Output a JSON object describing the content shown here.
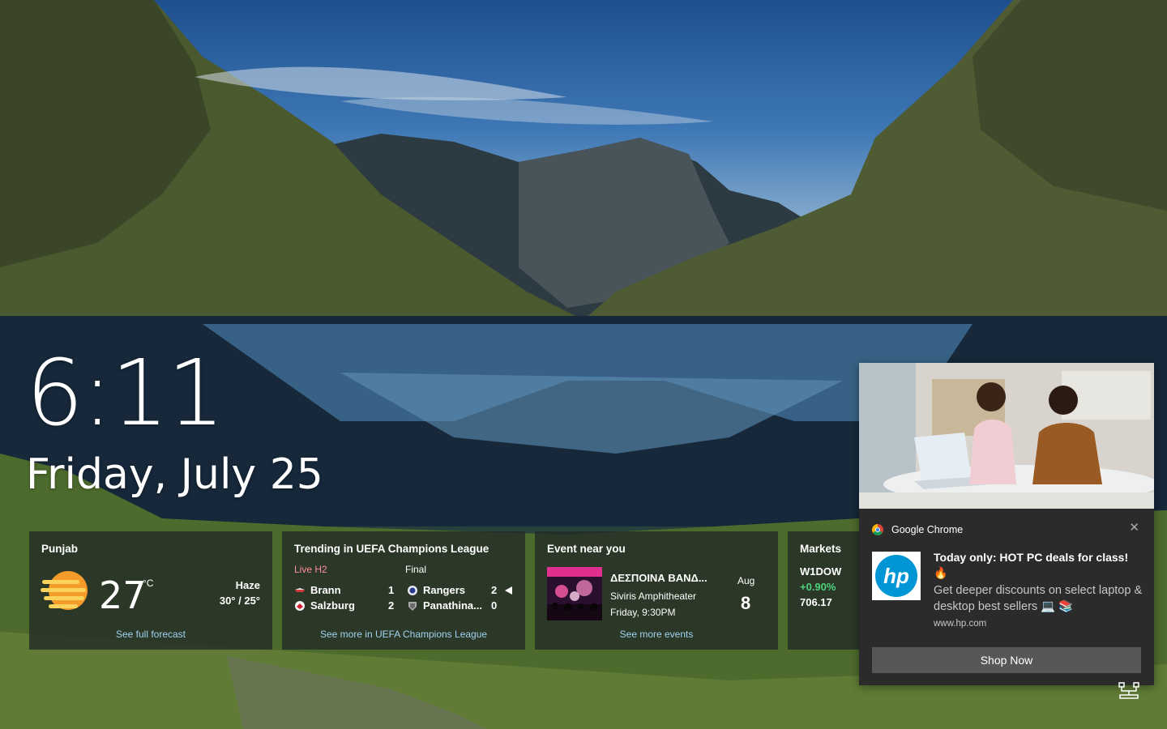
{
  "lock": {
    "time": "6:11",
    "date": "Friday, July 25"
  },
  "weather": {
    "location": "Punjab",
    "temp": "27",
    "unit": "°C",
    "condition": "Haze",
    "range": "30° / 25°",
    "link": "See full forecast",
    "icon": "haze-sun-icon"
  },
  "sports": {
    "title": "Trending in UEFA Champions League",
    "status_live": "Live H2",
    "status_final": "Final",
    "match1": {
      "home": "Brann",
      "home_score": "1",
      "away": "Salzburg",
      "away_score": "2"
    },
    "match2": {
      "home": "Rangers",
      "home_score": "2",
      "away": "Panathina...",
      "away_score": "0"
    },
    "link": "See more in UEFA Champions League"
  },
  "event": {
    "title": "Event near you",
    "name": "ΔΕΣΠΟΙΝΑ ΒΑΝΔ...",
    "venue": "Siviris Amphitheater",
    "when": "Friday, 9:30PM",
    "month": "Aug",
    "day": "8",
    "link": "See more events"
  },
  "markets": {
    "title": "Markets",
    "symbol": "W1DOW",
    "change": "+0.90%",
    "value": "706.17",
    "change_color": "#4fd27c"
  },
  "notification": {
    "app": "Google Chrome",
    "headline": "Today only: HOT PC deals for class!",
    "emoji": "🔥",
    "body": "Get deeper discounts on select laptop & desktop best sellers 💻 📚",
    "attribution": "www.hp.com",
    "action": "Shop Now",
    "close": "✕",
    "logo_text": "hp"
  },
  "colors": {
    "card_bg": "#21292780",
    "link": "#9fd3ef",
    "live": "#ff8f9a",
    "toast_bg": "#2b2b2b"
  }
}
